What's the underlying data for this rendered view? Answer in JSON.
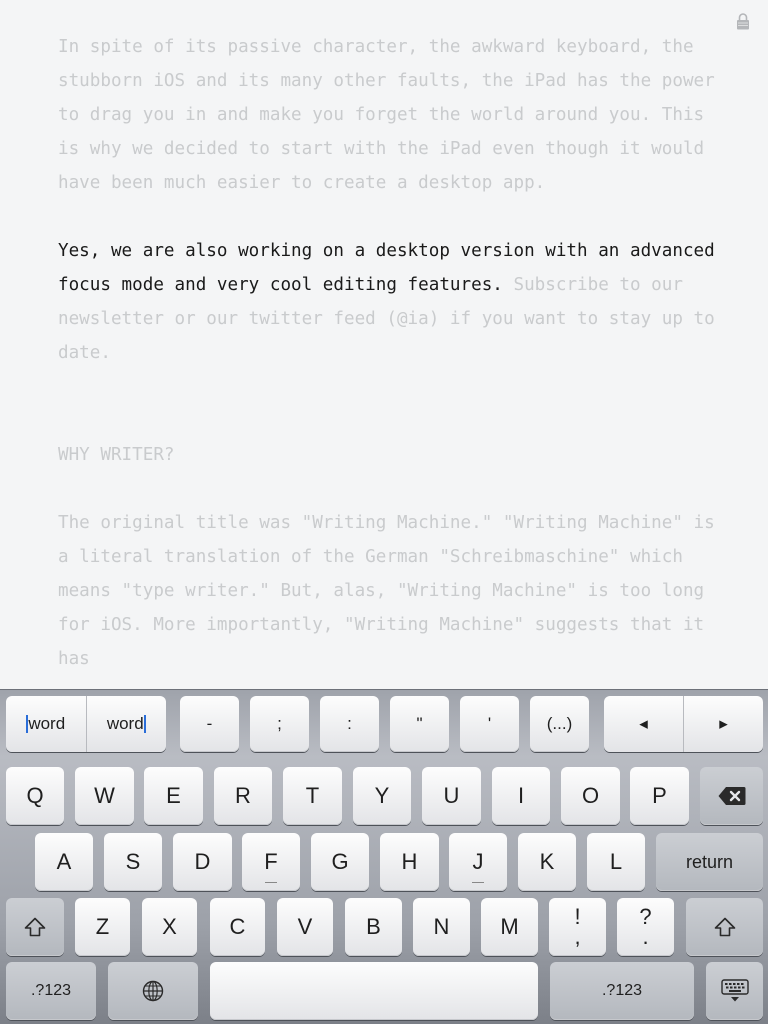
{
  "editor": {
    "paragraph1": "In spite of its passive character, the awkward keyboard, the stubborn iOS and its many other faults, the iPad has the power to drag you in and make you forget the world around you. This is why we decided to start with the iPad even though it would have been much easier to create a desktop app.",
    "focus_sentence": "Yes, we are also working on a desktop version with an advanced focus mode and very cool editing features.",
    "paragraph2_rest": "Subscribe to our newsletter or our twitter feed (@ia) if you want to stay up to date.",
    "heading": "WHY WRITER?",
    "paragraph3": "The original title was \"Writing Machine.\" \"Writing Machine\" is a literal translation of the German \"Schreibmaschine\" which means \"type writer.\" But, alas, \"Writing Machine\" is too long for iOS. More importantly, \"Writing Machine\" suggests that it has"
  },
  "extra_row": {
    "word_left": "word",
    "word_right": "word",
    "keys": [
      "-",
      ";",
      ":",
      "\"",
      "'",
      "(...)"
    ],
    "arrow_left": "◂",
    "arrow_right": "▸"
  },
  "keyboard": {
    "row1": [
      "Q",
      "W",
      "E",
      "R",
      "T",
      "Y",
      "U",
      "I",
      "O",
      "P"
    ],
    "row2": [
      "A",
      "S",
      "D",
      "F",
      "G",
      "H",
      "J",
      "K",
      "L"
    ],
    "return_label": "return",
    "row3": [
      "Z",
      "X",
      "C",
      "V",
      "B",
      "N",
      "M"
    ],
    "excl_top": "!",
    "excl_bottom": ",",
    "quest_top": "?",
    "quest_bottom": ".",
    "numbers_label": ".?123",
    "colors": {
      "text_dim": "#c9cbcd",
      "text_focus": "#1a1a1a",
      "cursor": "#2a6dd8"
    }
  }
}
